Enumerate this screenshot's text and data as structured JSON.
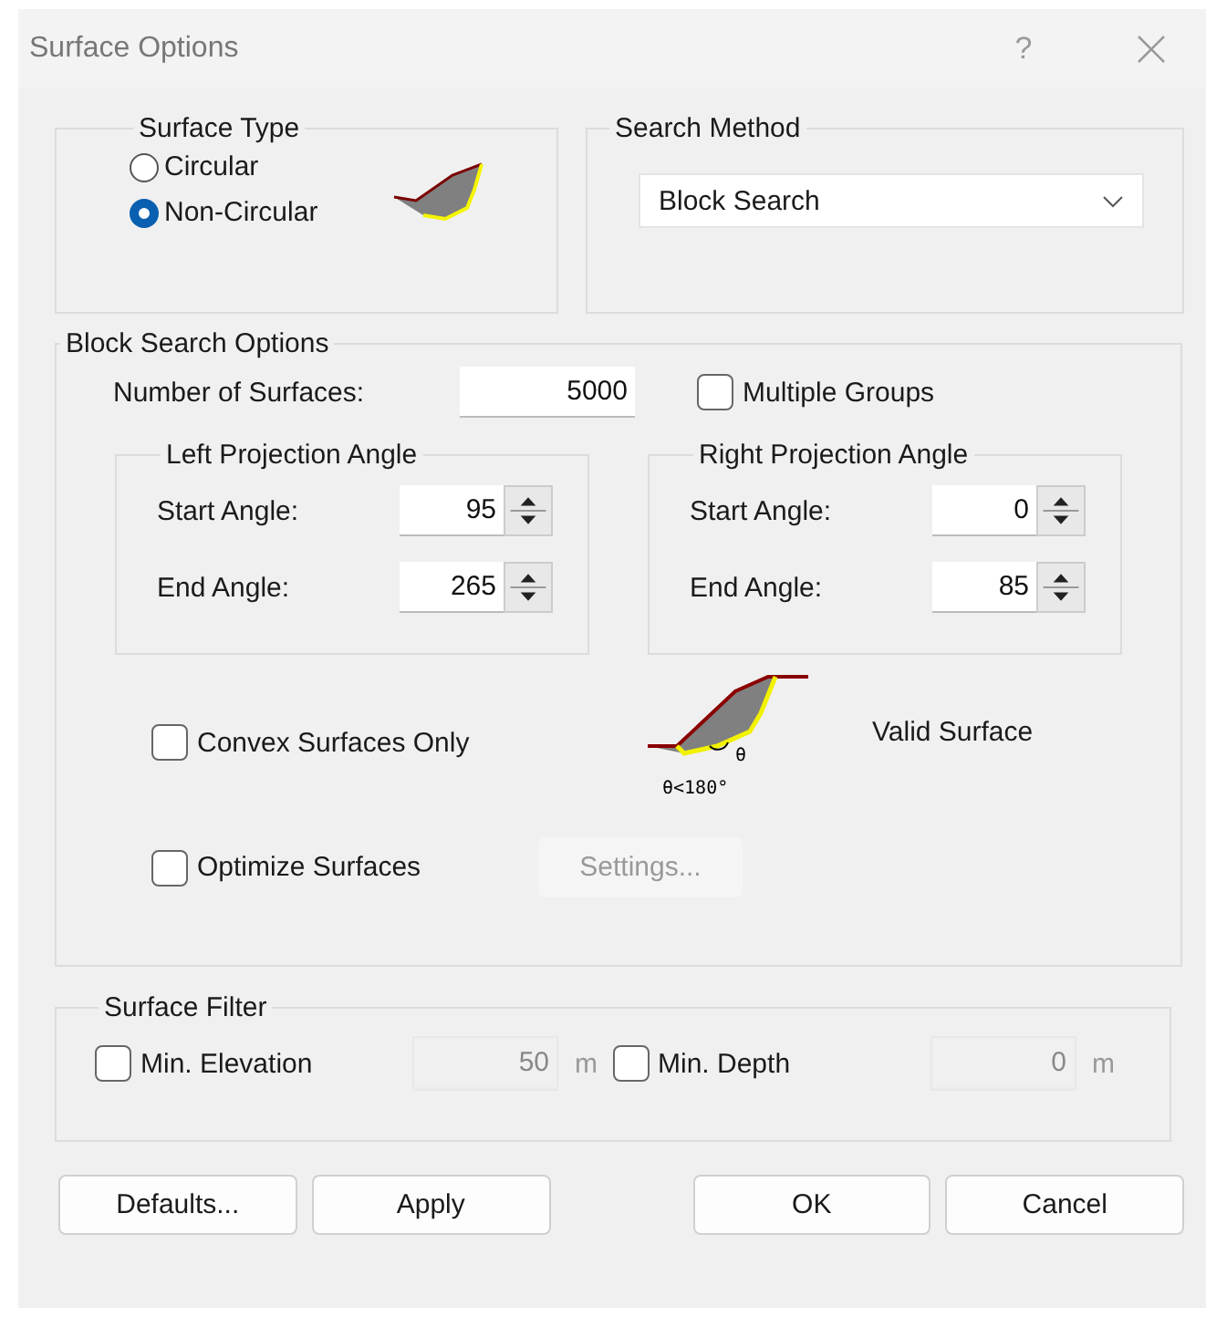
{
  "window": {
    "title": "Surface Options",
    "help": "?"
  },
  "surface_type": {
    "legend": "Surface Type",
    "options": [
      {
        "label": "Circular",
        "selected": false
      },
      {
        "label": "Non-Circular",
        "selected": true
      }
    ]
  },
  "search_method": {
    "legend": "Search Method",
    "value": "Block Search"
  },
  "block_search": {
    "legend": "Block Search Options",
    "number_of_surfaces": {
      "label": "Number of Surfaces:",
      "value": "5000"
    },
    "multiple_groups": {
      "label": "Multiple Groups",
      "checked": false
    },
    "angle_groups": [
      {
        "legend": "Left Projection Angle",
        "rows": [
          {
            "label": "Start Angle:",
            "value": "95"
          },
          {
            "label": "End Angle:",
            "value": "265"
          }
        ]
      },
      {
        "legend": "Right Projection Angle",
        "rows": [
          {
            "label": "Start Angle:",
            "value": "0"
          },
          {
            "label": "End Angle:",
            "value": "85"
          }
        ]
      }
    ],
    "convex": {
      "label": "Convex Surfaces Only",
      "checked": false
    },
    "diagram": {
      "angle_mark": "θ",
      "condition": "θ<180°",
      "caption": "Valid Surface"
    },
    "optimize": {
      "label": "Optimize Surfaces",
      "checked": false
    },
    "settings_button": {
      "label": "Settings...",
      "disabled": true
    }
  },
  "surface_filter": {
    "legend": "Surface Filter",
    "items": [
      {
        "label": "Min. Elevation",
        "checked": false,
        "value": "50",
        "unit": "m",
        "disabled": true
      },
      {
        "label": "Min. Depth",
        "checked": false,
        "value": "0",
        "unit": "m",
        "disabled": true
      }
    ]
  },
  "buttons": [
    {
      "label": "Defaults..."
    },
    {
      "label": "Apply"
    },
    {
      "label": "OK"
    },
    {
      "label": "Cancel"
    }
  ]
}
